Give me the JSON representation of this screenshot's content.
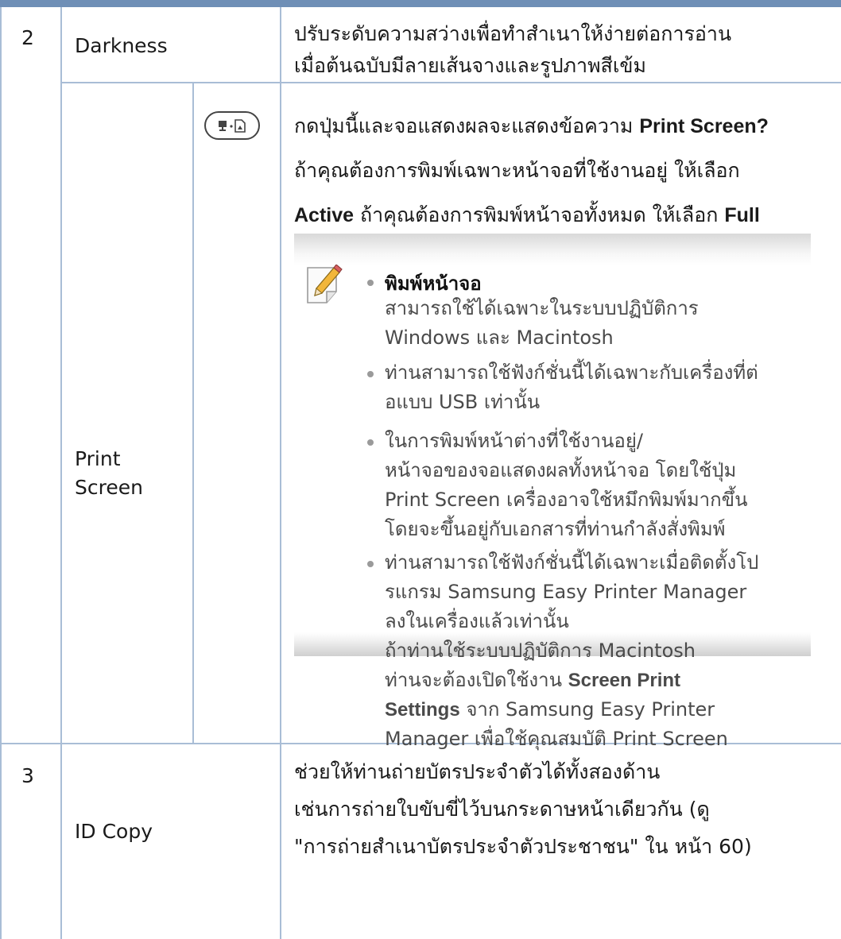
{
  "rows": [
    {
      "num": "2",
      "label": "Darkness",
      "desc_lines": [
        [
          {
            "t": "ปรับระดับความสว่างเพื่อทำสำเนาให้ง่ายต่อการอ่าน",
            "b": false
          }
        ],
        [
          {
            "t": "เมื่อต้นฉบับมีลายเส้นจางและรูปภาพสีเข้ม",
            "b": false
          }
        ]
      ]
    },
    {
      "label_lines": [
        "Print",
        "Screen"
      ],
      "button_icon": "print-screen-button-icon",
      "desc_lines": [
        [
          {
            "t": "กดปุ่มนี้และจอแสดงผลจะแสดงข้อความ ",
            "b": false
          },
          {
            "t": "Print Screen?",
            "b": true
          }
        ],
        [
          {
            "t": "ถ้าคุณต้องการพิมพ์เฉพาะหน้าจอที่ใช้งานอยู่ ให้เลือก",
            "b": false
          }
        ],
        [
          {
            "t": "Active",
            "b": true
          },
          {
            "t": " ถ้าคุณต้องการพิมพ์หน้าจอทั้งหมด ให้เลือก ",
            "b": false
          },
          {
            "t": "Full",
            "b": true
          }
        ]
      ],
      "note": {
        "icon": "note-pencil-icon",
        "items": [
          {
            "title": "พิมพ์หน้าจอ",
            "lines": [
              [
                {
                  "t": "สามารถใช้ได้เฉพาะในระบบปฏิบัติการ",
                  "b": false
                }
              ],
              [
                {
                  "t": "Windows และ Macintosh",
                  "b": false
                }
              ]
            ]
          },
          {
            "lines": [
              [
                {
                  "t": "ท่านสามารถใช้ฟังก์ชั่นนี้ได้เฉพาะกับเครื่องที่ต่",
                  "b": false
                }
              ],
              [
                {
                  "t": "อแบบ USB เท่านั้น",
                  "b": false
                }
              ]
            ]
          },
          {
            "lines": [
              [
                {
                  "t": "ในการพิมพ์หน้าต่างที่ใช้งานอยู่/",
                  "b": false
                }
              ],
              [
                {
                  "t": "หน้าจอของจอแสดงผลทั้งหน้าจอ โดยใช้ปุ่ม",
                  "b": false
                }
              ],
              [
                {
                  "t": "Print Screen เครื่องอาจใช้หมึกพิมพ์มากขึ้น",
                  "b": false
                }
              ],
              [
                {
                  "t": "โดยจะขึ้นอยู่กับเอกสารที่ท่านกำลังสั่งพิมพ์",
                  "b": false
                }
              ]
            ]
          },
          {
            "lines": [
              [
                {
                  "t": "ท่านสามารถใช้ฟังก์ชั่นนี้ได้เฉพาะเมื่อติดตั้งโป",
                  "b": false
                }
              ],
              [
                {
                  "t": "รแกรม Samsung Easy Printer Manager",
                  "b": false
                }
              ],
              [
                {
                  "t": "ลงในเครื่องแล้วเท่านั้น",
                  "b": false
                }
              ],
              [
                {
                  "t": "ถ้าท่านใช้ระบบปฏิบัติการ Macintosh",
                  "b": false
                }
              ],
              [
                {
                  "t": "ท่านจะต้องเปิดใช้งาน ",
                  "b": false
                },
                {
                  "t": "Screen Print",
                  "b": true
                }
              ],
              [
                {
                  "t": "Settings",
                  "b": true
                },
                {
                  "t": " จาก Samsung Easy Printer",
                  "b": false
                }
              ],
              [
                {
                  "t": "Manager เพื่อใช้คุณสมบัติ Print Screen",
                  "b": false
                }
              ]
            ]
          }
        ]
      }
    },
    {
      "num": "3",
      "label": "ID Copy",
      "desc_lines": [
        [
          {
            "t": "ช่วยให้ท่านถ่ายบัตรประจำตัวได้ทั้งสองด้าน",
            "b": false
          }
        ],
        [
          {
            "t": "เช่นการถ่ายใบขับขี่ไว้บนกระดาษหน้าเดียวกัน (ดู",
            "b": false
          }
        ],
        [
          {
            "t": "\"การถ่ายสำเนาบัตรประจำตัวประชาชน\"  ใน หน้า 60)",
            "b": false
          }
        ]
      ]
    }
  ],
  "colors": {
    "header_bar": "#6f8fb6",
    "grid": "#a9bdd6",
    "note_text": "#4a4a4a"
  }
}
